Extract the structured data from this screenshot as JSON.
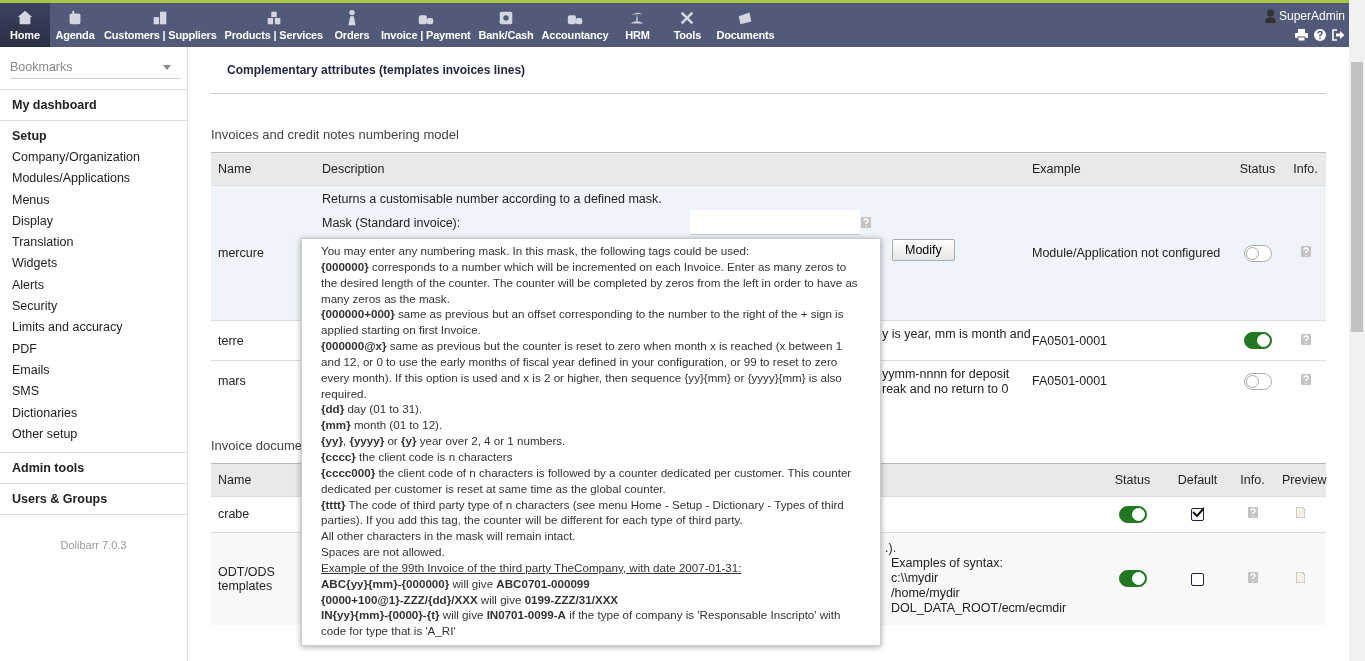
{
  "top_menu": {
    "items": [
      {
        "label": "Home",
        "selected": true
      },
      {
        "label": "Agenda",
        "selected": false
      },
      {
        "label": "Customers | Suppliers",
        "selected": false
      },
      {
        "label": "Products | Services",
        "selected": false
      },
      {
        "label": "Orders",
        "selected": false
      },
      {
        "label": "Invoice | Payment",
        "selected": false
      },
      {
        "label": "Bank/Cash",
        "selected": false
      },
      {
        "label": "Accountancy",
        "selected": false
      },
      {
        "label": "HRM",
        "selected": false
      },
      {
        "label": "Tools",
        "selected": false
      },
      {
        "label": "Documents",
        "selected": false
      }
    ],
    "user": "SuperAdmin"
  },
  "sidebar": {
    "bookmarks": "Bookmarks",
    "sections": [
      {
        "title": "My dashboard"
      },
      {
        "title": "Setup",
        "items": [
          "Company/Organization",
          "Modules/Applications",
          "Menus",
          "Display",
          "Translation",
          "Widgets",
          "Alerts",
          "Security",
          "Limits and accuracy",
          "PDF",
          "Emails",
          "SMS",
          "Dictionaries",
          "Other setup"
        ]
      },
      {
        "title": "Admin tools"
      },
      {
        "title": "Users & Groups"
      }
    ],
    "version": "Dolibarr 7.0.3"
  },
  "tab": {
    "label": "Complementary attributes (templates invoices lines)"
  },
  "numbering": {
    "heading": "Invoices and credit notes numbering model",
    "columns": [
      "Name",
      "Description",
      "Example",
      "Status",
      "Info."
    ],
    "rows": [
      {
        "kind": "mask",
        "name": "mercure",
        "highlighted": true,
        "description": "Returns a customisable number according to a defined mask.",
        "mask_label": "Mask (Standard invoice):",
        "button": "Modify",
        "example": "Module/Application not configured",
        "on": false
      },
      {
        "kind": "fragment",
        "name": "terre",
        "highlighted": false,
        "fragment": [
          "y is year, mm is month and"
        ],
        "example": "FA0501-0001",
        "on": true
      },
      {
        "kind": "fragment",
        "name": "mars",
        "highlighted": false,
        "fragment": [
          "yymm-nnnn for deposit",
          "reak and no return to 0"
        ],
        "example": "FA0501-0001",
        "on": false
      }
    ]
  },
  "documents": {
    "heading": "Invoice docume",
    "columns": [
      "Name",
      "Status",
      "Default",
      "Info.",
      "Preview"
    ],
    "rows": [
      {
        "name": "crabe",
        "on": true,
        "default": true
      },
      {
        "name": "ODT/ODS templates",
        "fragment": [
          ".).",
          "Examples of syntax:",
          "c:\\\\mydir",
          "/home/mydir",
          "DOL_DATA_ROOT/ecm/ecmdir"
        ],
        "on": true,
        "default": false
      }
    ]
  },
  "tooltip": {
    "paragraphs": [
      {
        "kind": "text",
        "text": "You may enter any numbering mask. In this mask, the following tags could be used:"
      },
      {
        "kind": "text",
        "text": "**{000000}** corresponds to a number which will be incremented on each Invoice. Enter as many zeros to the desired length of the counter. The counter will be completed by zeros from the left in order to have as many zeros as the mask."
      },
      {
        "kind": "text",
        "text": "**{000000+000}** same as previous but an offset corresponding to the number to the right of the + sign is applied starting on first Invoice."
      },
      {
        "kind": "text",
        "text": "**{000000@x}** same as previous but the counter is reset to zero when month x is reached (x between 1 and 12, or 0 to use the early months of fiscal year defined in your configuration, or 99 to reset to zero every month). If this option is used and x is 2 or higher, then sequence {yy}{mm} or {yyyy}{mm} is also required."
      },
      {
        "kind": "text",
        "text": "**{dd}** day (01 to 31)."
      },
      {
        "kind": "text",
        "text": "**{mm}** month (01 to 12)."
      },
      {
        "kind": "text",
        "text": "**{yy}**, **{yyyy}** or **{y}** year over 2, 4 or 1 numbers."
      },
      {
        "kind": "text",
        "text": "**{cccc}** the client code is n characters"
      },
      {
        "kind": "text",
        "text": "**{cccc000}** the client code of n characters is followed by a counter dedicated per customer. This counter dedicated per customer is reset at same time as the global counter."
      },
      {
        "kind": "text",
        "text": "**{tttt}** The code of third party type of n characters (see menu Home - Setup - Dictionary - Types of third parties). If you add this tag, the counter will be different for each type of third party."
      },
      {
        "kind": "text",
        "text": "All other characters in the mask will remain intact."
      },
      {
        "kind": "text",
        "text": "Spaces are not allowed."
      },
      {
        "kind": "example",
        "text": "Example of the 99th Invoice of the third party TheCompany, with date 2007-01-31:"
      },
      {
        "kind": "text",
        "text": "**ABC{yy}{mm}-{000000}** will give **ABC0701-000099**"
      },
      {
        "kind": "text",
        "text": "**{0000+100@1}-ZZZ/{dd}/XXX** will give **0199-ZZZ/31/XXX**"
      },
      {
        "kind": "text",
        "text": "**IN{yy}{mm}-{0000}-{t}** will give **IN0701-0099-A** if the type of company is 'Responsable Inscripto' with code for type that is 'A_RI'"
      }
    ]
  }
}
